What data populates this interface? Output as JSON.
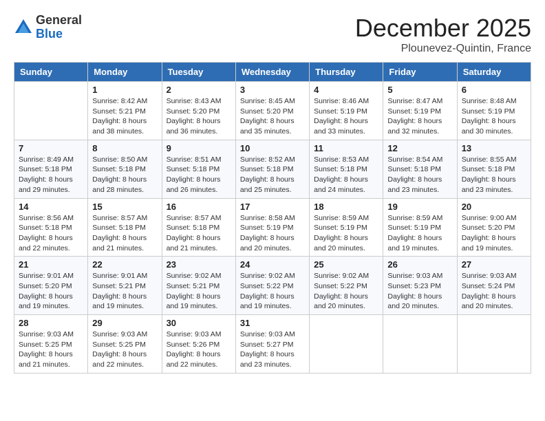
{
  "logo": {
    "general": "General",
    "blue": "Blue"
  },
  "title": "December 2025",
  "location": "Plounevez-Quintin, France",
  "days_of_week": [
    "Sunday",
    "Monday",
    "Tuesday",
    "Wednesday",
    "Thursday",
    "Friday",
    "Saturday"
  ],
  "weeks": [
    [
      {
        "day": "",
        "info": ""
      },
      {
        "day": "1",
        "info": "Sunrise: 8:42 AM\nSunset: 5:21 PM\nDaylight: 8 hours\nand 38 minutes."
      },
      {
        "day": "2",
        "info": "Sunrise: 8:43 AM\nSunset: 5:20 PM\nDaylight: 8 hours\nand 36 minutes."
      },
      {
        "day": "3",
        "info": "Sunrise: 8:45 AM\nSunset: 5:20 PM\nDaylight: 8 hours\nand 35 minutes."
      },
      {
        "day": "4",
        "info": "Sunrise: 8:46 AM\nSunset: 5:19 PM\nDaylight: 8 hours\nand 33 minutes."
      },
      {
        "day": "5",
        "info": "Sunrise: 8:47 AM\nSunset: 5:19 PM\nDaylight: 8 hours\nand 32 minutes."
      },
      {
        "day": "6",
        "info": "Sunrise: 8:48 AM\nSunset: 5:19 PM\nDaylight: 8 hours\nand 30 minutes."
      }
    ],
    [
      {
        "day": "7",
        "info": "Sunrise: 8:49 AM\nSunset: 5:18 PM\nDaylight: 8 hours\nand 29 minutes."
      },
      {
        "day": "8",
        "info": "Sunrise: 8:50 AM\nSunset: 5:18 PM\nDaylight: 8 hours\nand 28 minutes."
      },
      {
        "day": "9",
        "info": "Sunrise: 8:51 AM\nSunset: 5:18 PM\nDaylight: 8 hours\nand 26 minutes."
      },
      {
        "day": "10",
        "info": "Sunrise: 8:52 AM\nSunset: 5:18 PM\nDaylight: 8 hours\nand 25 minutes."
      },
      {
        "day": "11",
        "info": "Sunrise: 8:53 AM\nSunset: 5:18 PM\nDaylight: 8 hours\nand 24 minutes."
      },
      {
        "day": "12",
        "info": "Sunrise: 8:54 AM\nSunset: 5:18 PM\nDaylight: 8 hours\nand 23 minutes."
      },
      {
        "day": "13",
        "info": "Sunrise: 8:55 AM\nSunset: 5:18 PM\nDaylight: 8 hours\nand 23 minutes."
      }
    ],
    [
      {
        "day": "14",
        "info": "Sunrise: 8:56 AM\nSunset: 5:18 PM\nDaylight: 8 hours\nand 22 minutes."
      },
      {
        "day": "15",
        "info": "Sunrise: 8:57 AM\nSunset: 5:18 PM\nDaylight: 8 hours\nand 21 minutes."
      },
      {
        "day": "16",
        "info": "Sunrise: 8:57 AM\nSunset: 5:18 PM\nDaylight: 8 hours\nand 21 minutes."
      },
      {
        "day": "17",
        "info": "Sunrise: 8:58 AM\nSunset: 5:19 PM\nDaylight: 8 hours\nand 20 minutes."
      },
      {
        "day": "18",
        "info": "Sunrise: 8:59 AM\nSunset: 5:19 PM\nDaylight: 8 hours\nand 20 minutes."
      },
      {
        "day": "19",
        "info": "Sunrise: 8:59 AM\nSunset: 5:19 PM\nDaylight: 8 hours\nand 19 minutes."
      },
      {
        "day": "20",
        "info": "Sunrise: 9:00 AM\nSunset: 5:20 PM\nDaylight: 8 hours\nand 19 minutes."
      }
    ],
    [
      {
        "day": "21",
        "info": "Sunrise: 9:01 AM\nSunset: 5:20 PM\nDaylight: 8 hours\nand 19 minutes."
      },
      {
        "day": "22",
        "info": "Sunrise: 9:01 AM\nSunset: 5:21 PM\nDaylight: 8 hours\nand 19 minutes."
      },
      {
        "day": "23",
        "info": "Sunrise: 9:02 AM\nSunset: 5:21 PM\nDaylight: 8 hours\nand 19 minutes."
      },
      {
        "day": "24",
        "info": "Sunrise: 9:02 AM\nSunset: 5:22 PM\nDaylight: 8 hours\nand 19 minutes."
      },
      {
        "day": "25",
        "info": "Sunrise: 9:02 AM\nSunset: 5:22 PM\nDaylight: 8 hours\nand 20 minutes."
      },
      {
        "day": "26",
        "info": "Sunrise: 9:03 AM\nSunset: 5:23 PM\nDaylight: 8 hours\nand 20 minutes."
      },
      {
        "day": "27",
        "info": "Sunrise: 9:03 AM\nSunset: 5:24 PM\nDaylight: 8 hours\nand 20 minutes."
      }
    ],
    [
      {
        "day": "28",
        "info": "Sunrise: 9:03 AM\nSunset: 5:25 PM\nDaylight: 8 hours\nand 21 minutes."
      },
      {
        "day": "29",
        "info": "Sunrise: 9:03 AM\nSunset: 5:25 PM\nDaylight: 8 hours\nand 22 minutes."
      },
      {
        "day": "30",
        "info": "Sunrise: 9:03 AM\nSunset: 5:26 PM\nDaylight: 8 hours\nand 22 minutes."
      },
      {
        "day": "31",
        "info": "Sunrise: 9:03 AM\nSunset: 5:27 PM\nDaylight: 8 hours\nand 23 minutes."
      },
      {
        "day": "",
        "info": ""
      },
      {
        "day": "",
        "info": ""
      },
      {
        "day": "",
        "info": ""
      }
    ]
  ]
}
